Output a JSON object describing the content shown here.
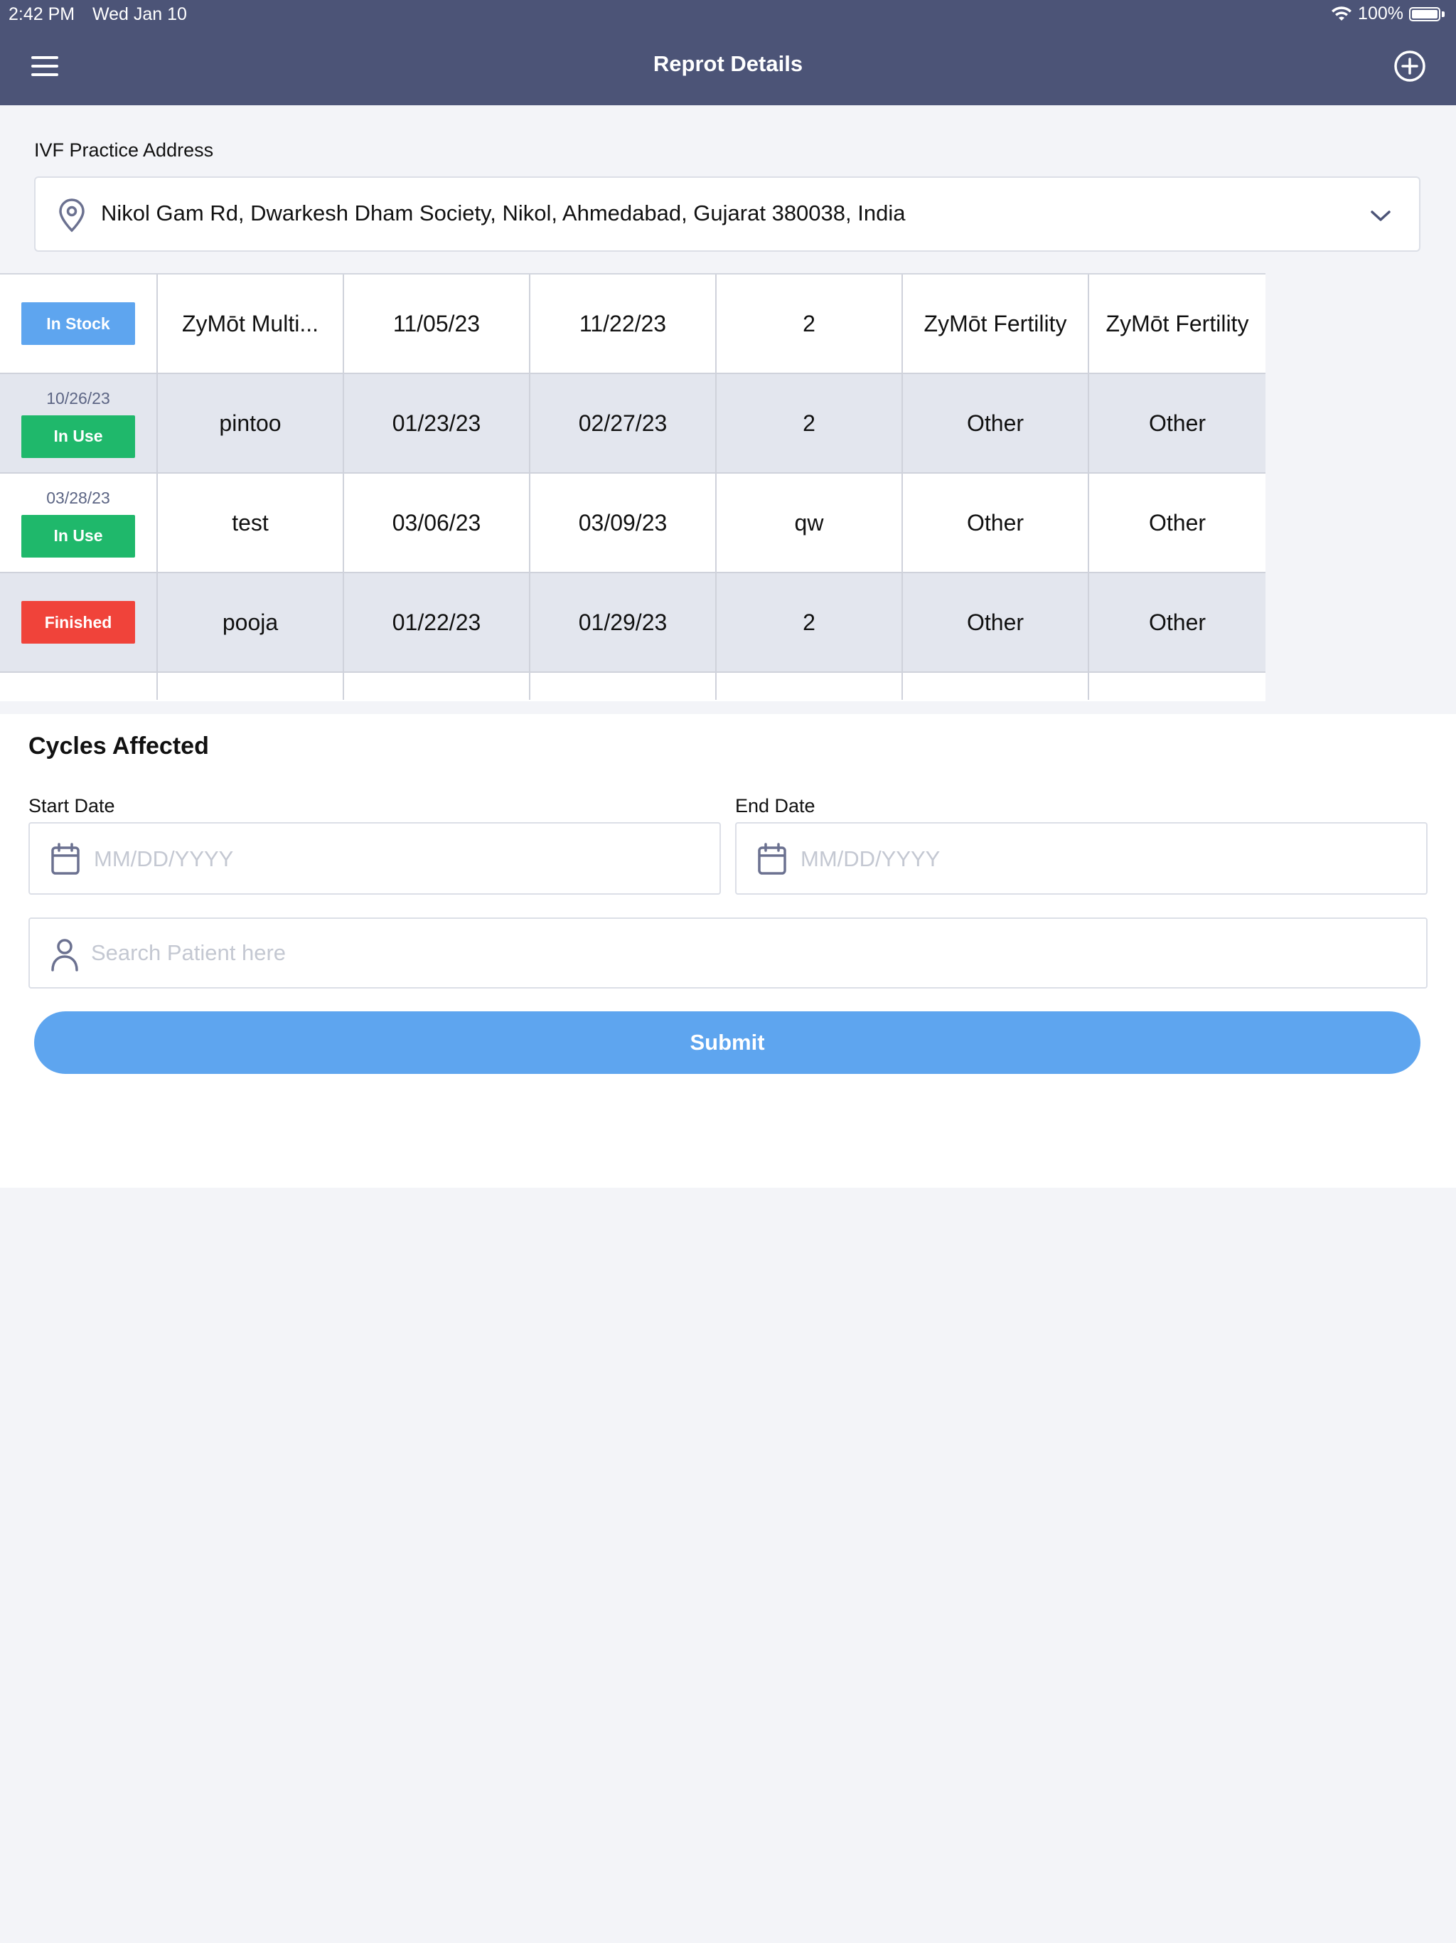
{
  "status_bar": {
    "time": "2:42 PM",
    "date": "Wed Jan 10",
    "battery": "100%"
  },
  "header": {
    "title": "Reprot Details"
  },
  "address": {
    "label": "IVF Practice Address",
    "value": "Nikol Gam Rd, Dwarkesh Dham Society, Nikol, Ahmedabad, Gujarat 380038, India"
  },
  "colors": {
    "header_bg": "#4c5477",
    "in_stock": "#5ea5ef",
    "in_use": "#1fb86b",
    "finished": "#f0433a",
    "submit": "#5ea5ef"
  },
  "table": {
    "rows": [
      {
        "date": "",
        "status": "In Stock",
        "status_color": "#5ea5ef",
        "name": "ZyMōt Multi...",
        "start": "11/05/23",
        "end": "11/22/23",
        "qty": "2",
        "col5": "ZyMōt Fertility",
        "col6": "ZyMōt Fertility"
      },
      {
        "date": "10/26/23",
        "status": "In Use",
        "status_color": "#1fb86b",
        "name": "pintoo",
        "start": "01/23/23",
        "end": "02/27/23",
        "qty": "2",
        "col5": "Other",
        "col6": "Other"
      },
      {
        "date": "03/28/23",
        "status": "In Use",
        "status_color": "#1fb86b",
        "name": "test",
        "start": "03/06/23",
        "end": "03/09/23",
        "qty": "qw",
        "col5": "Other",
        "col6": "Other"
      },
      {
        "date": "",
        "status": "Finished",
        "status_color": "#f0433a",
        "name": "pooja",
        "start": "01/22/23",
        "end": "01/29/23",
        "qty": "2",
        "col5": "Other",
        "col6": "Other"
      }
    ]
  },
  "cycles": {
    "title": "Cycles Affected",
    "start_label": "Start Date",
    "start_placeholder": "MM/DD/YYYY",
    "end_label": "End Date",
    "end_placeholder": "MM/DD/YYYY",
    "search_placeholder": "Search Patient here",
    "submit_label": "Submit"
  }
}
